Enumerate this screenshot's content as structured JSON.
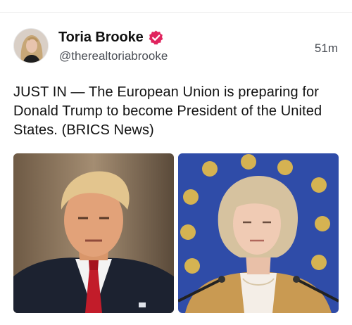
{
  "post": {
    "author": {
      "display_name": "Toria Brooke",
      "handle": "@therealtoriabrooke",
      "verified": true,
      "avatar_icon": "profile-photo-avatar"
    },
    "timestamp": "51m",
    "text": "JUST IN — The European Union is preparing for Donald Trump to become President of the United States. (BRICS News)",
    "media": [
      {
        "icon": "portrait-photo-man-suit-red-tie"
      },
      {
        "icon": "portrait-photo-woman-eu-flag-background"
      }
    ]
  },
  "colors": {
    "verified_badge": "#e0245e",
    "text": "#111111",
    "muted": "#4b4f56",
    "eu_blue": "#2f4ca8",
    "eu_gold": "#f2c544"
  }
}
